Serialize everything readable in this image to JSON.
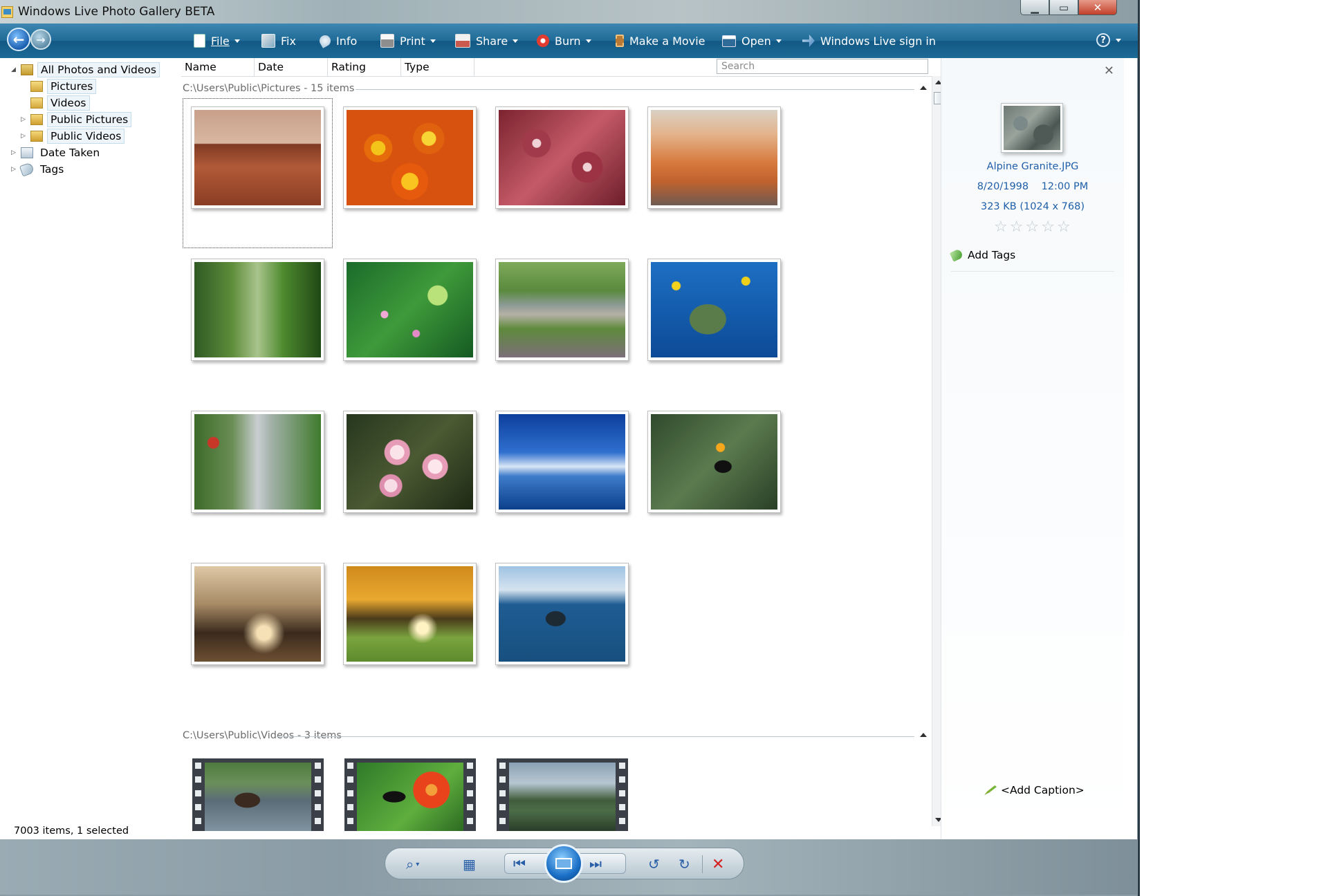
{
  "window": {
    "title": "Windows Live Photo Gallery BETA"
  },
  "toolbar": {
    "file": "File",
    "fix": "Fix",
    "info": "Info",
    "print": "Print",
    "share": "Share",
    "burn": "Burn",
    "make_movie": "Make a Movie",
    "open": "Open",
    "signin": "Windows Live sign in",
    "help": "?"
  },
  "nav": {
    "all": "All Photos and Videos",
    "pictures": "Pictures",
    "videos": "Videos",
    "public_pictures": "Public Pictures",
    "public_videos": "Public Videos",
    "date_taken": "Date Taken",
    "tags": "Tags"
  },
  "status": "7003 items, 1 selected",
  "columns": {
    "name": "Name",
    "date": "Date",
    "rating": "Rating",
    "type": "Type"
  },
  "search": {
    "placeholder": "Search"
  },
  "groups": {
    "pictures": "C:\\Users\\Public\\Pictures - 15 items",
    "videos": "C:\\Users\\Public\\Videos - 3 items"
  },
  "info": {
    "filename": "Alpine Granite.JPG",
    "date": "8/20/1998",
    "time": "12:00 PM",
    "size": "323 KB (1024 x 768)",
    "rating": 0,
    "add_tags": "Add Tags",
    "add_caption": "<Add Caption>"
  }
}
